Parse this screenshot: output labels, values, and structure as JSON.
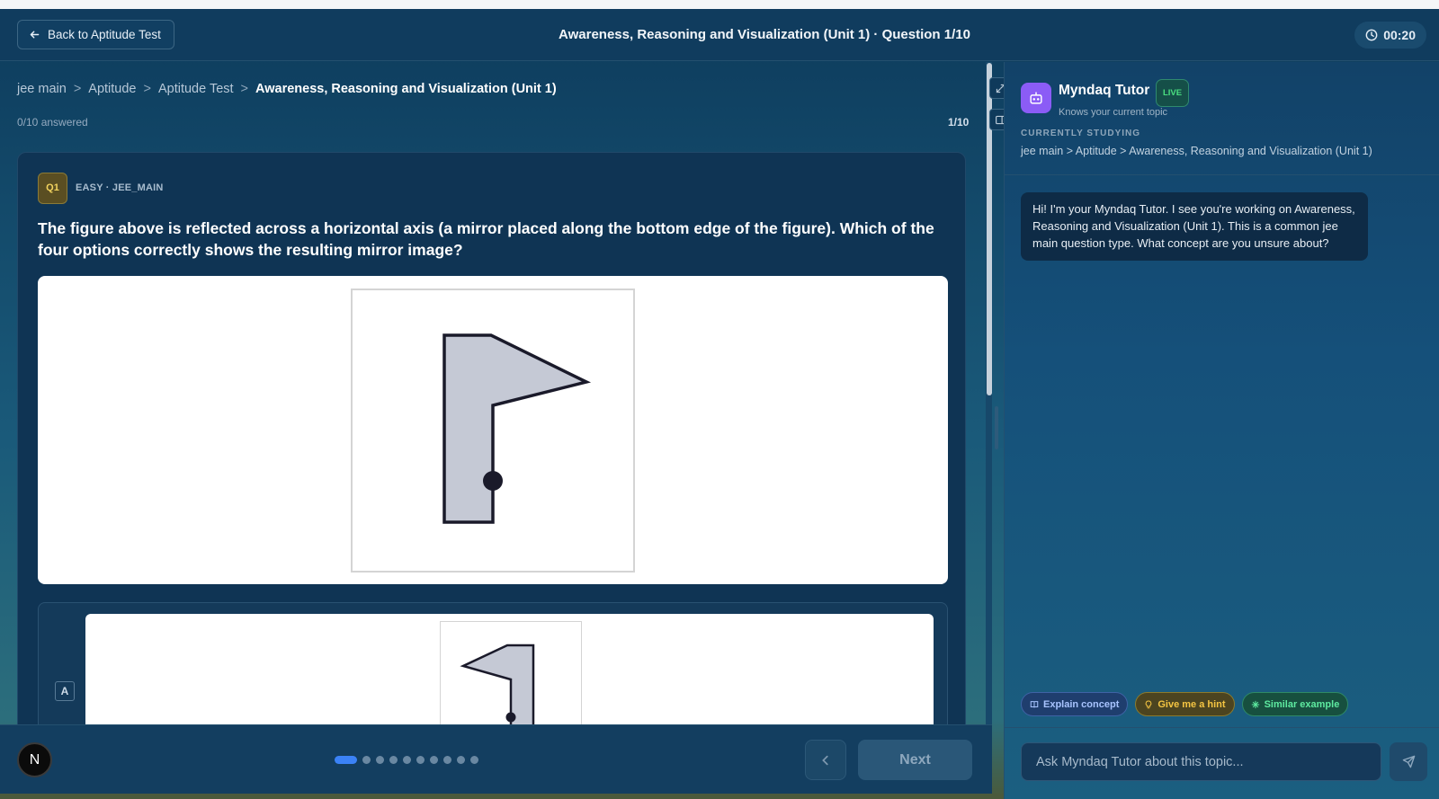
{
  "header": {
    "back_label": "Back to Aptitude Test",
    "title": "Awareness, Reasoning and Visualization (Unit 1) · Question 1/10",
    "timer": "00:20"
  },
  "breadcrumb": {
    "items": [
      "jee main",
      "Aptitude",
      "Aptitude Test",
      "Awareness, Reasoning and Visualization (Unit 1)"
    ],
    "separator": ">"
  },
  "progress": {
    "answered": "0/10 answered",
    "counter": "1/10",
    "total_questions": 10,
    "current_index": 1
  },
  "question": {
    "badge": "Q1",
    "meta": "EASY · JEE_MAIN",
    "text": "The figure above is reflected across a horizontal axis (a mirror placed along the bottom edge of the figure). Which of the four options correctly shows the resulting mirror image?",
    "figure_fill": "#c5c9d5",
    "figure_stroke": "#1a1a2a"
  },
  "options": [
    {
      "letter": "A"
    }
  ],
  "footer": {
    "avatar_letter": "N",
    "prev_icon": "chevron-left-icon",
    "next_label": "Next"
  },
  "tutor": {
    "name": "Myndaq Tutor",
    "live_label": "LIVE",
    "subtitle": "Knows your current topic",
    "currently_label": "CURRENTLY STUDYING",
    "currently_path": "jee main > Aptitude > Awareness, Reasoning and Visualization (Unit 1)",
    "message": "Hi! I'm your Myndaq Tutor. I see you're working on Awareness, Reasoning and Visualization (Unit 1). This is a common jee main question type. What concept are you unsure about?",
    "chips": {
      "explain": "Explain concept",
      "hint": "Give me a hint",
      "similar": "Similar example"
    },
    "input_placeholder": "Ask Myndaq Tutor about this topic..."
  },
  "colors": {
    "accent": "#3b82f6",
    "bot": "#8b5cf6",
    "live": "#4ade80",
    "badge_gold": "#f2d35e"
  }
}
